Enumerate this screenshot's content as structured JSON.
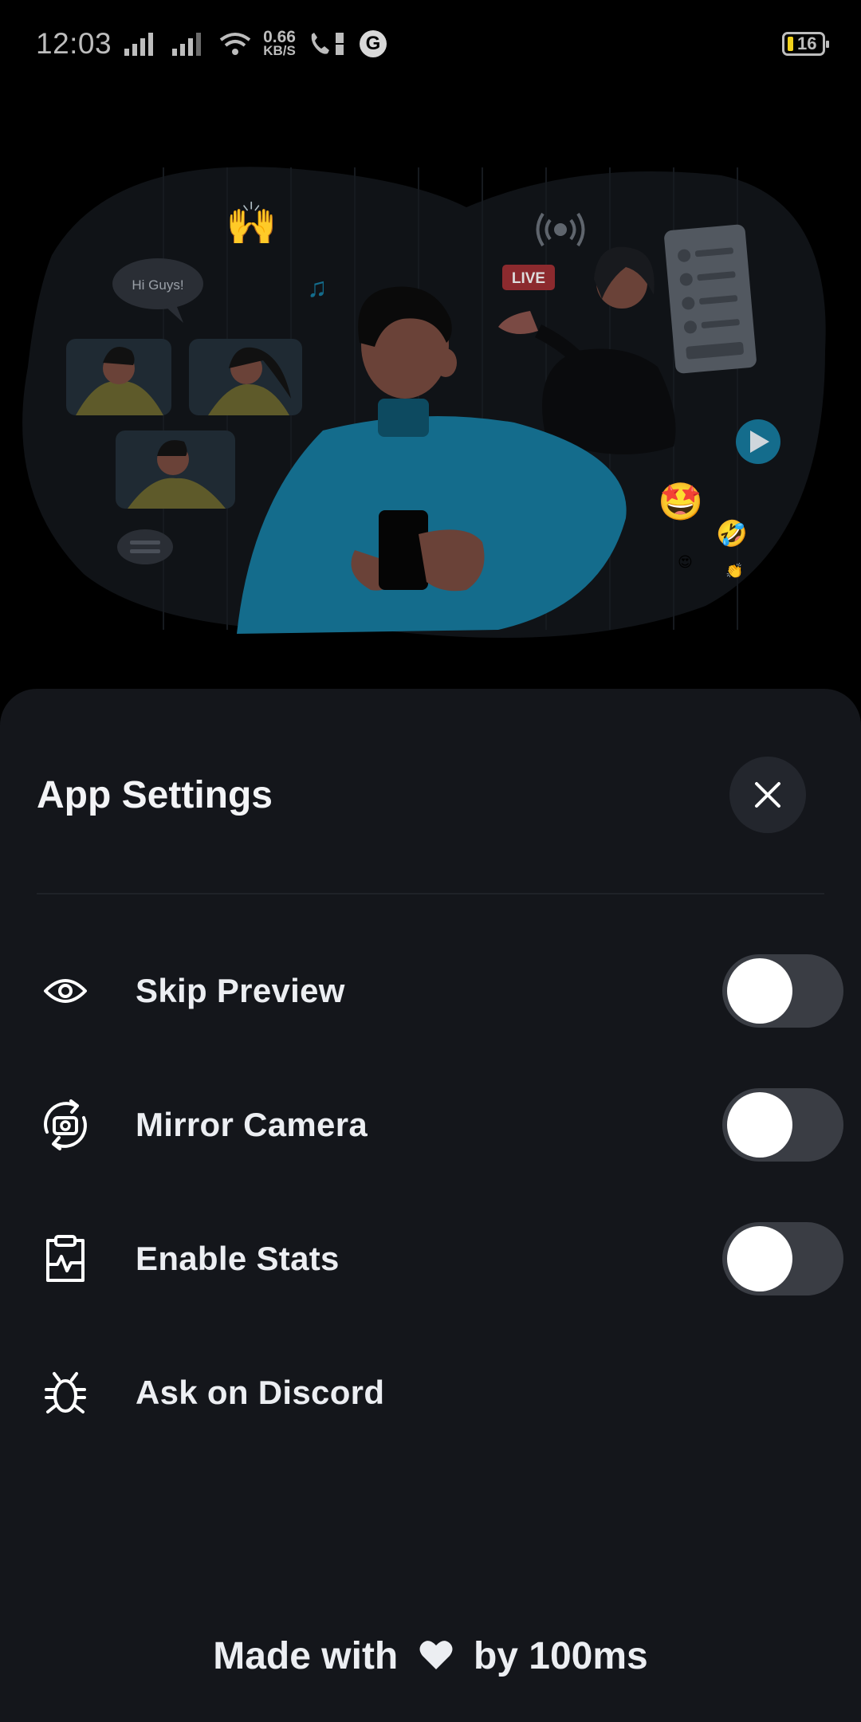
{
  "status_bar": {
    "time": "12:03",
    "net_speed_value": "0.66",
    "net_speed_unit": "KB/S",
    "battery": "16",
    "google_letter": "G"
  },
  "illustration": {
    "speech_bubble": "Hi Guys!",
    "live_badge": "LIVE"
  },
  "sheet": {
    "title": "App Settings",
    "close_icon": "close-icon",
    "items": [
      {
        "label": "Skip Preview",
        "icon": "eye-icon",
        "has_toggle": true,
        "on": false
      },
      {
        "label": "Mirror Camera",
        "icon": "camera-rotate-icon",
        "has_toggle": true,
        "on": false
      },
      {
        "label": "Enable Stats",
        "icon": "stats-clipboard-icon",
        "has_toggle": true,
        "on": false
      },
      {
        "label": "Ask on Discord",
        "icon": "bug-icon",
        "has_toggle": false
      }
    ],
    "footer": {
      "prefix": "Made with",
      "suffix": "by 100ms"
    }
  },
  "colors": {
    "sheet_bg": "#14161b",
    "toggle_off": "#3a3d44",
    "accent_blue": "#146c8c"
  }
}
